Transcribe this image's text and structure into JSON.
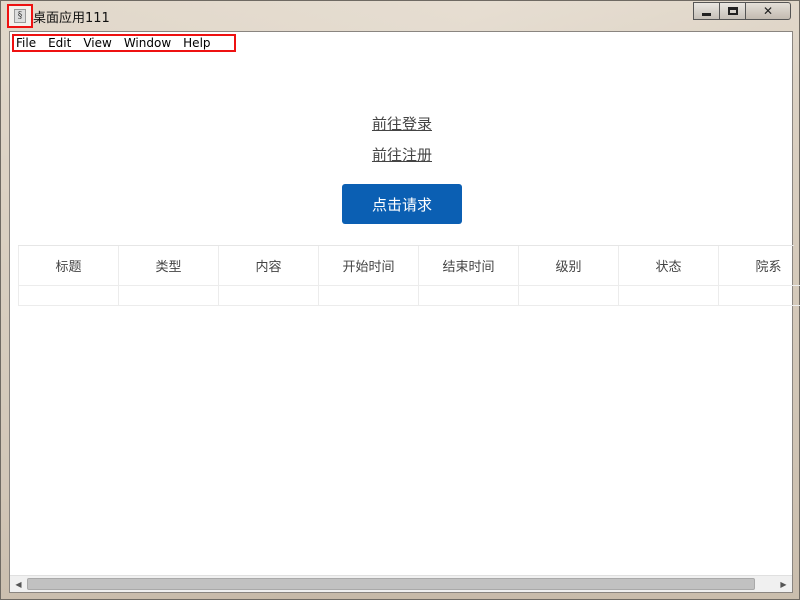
{
  "window": {
    "title": "桌面应用111",
    "icon": "app-icon",
    "controls": {
      "minimize": "minimize-icon",
      "maximize": "maximize-icon",
      "close": "✕"
    }
  },
  "menubar": {
    "items": [
      "File",
      "Edit",
      "View",
      "Window",
      "Help"
    ]
  },
  "links": {
    "login": "前往登录",
    "register": "前往注册"
  },
  "request_button": {
    "label": "点击请求",
    "color": "#0b5fb3"
  },
  "table": {
    "headers": [
      "标题",
      "类型",
      "内容",
      "开始时间",
      "结束时间",
      "级别",
      "状态",
      "院系"
    ]
  },
  "scrollbar": {
    "left_arrow": "◀",
    "right_arrow": "▶"
  }
}
